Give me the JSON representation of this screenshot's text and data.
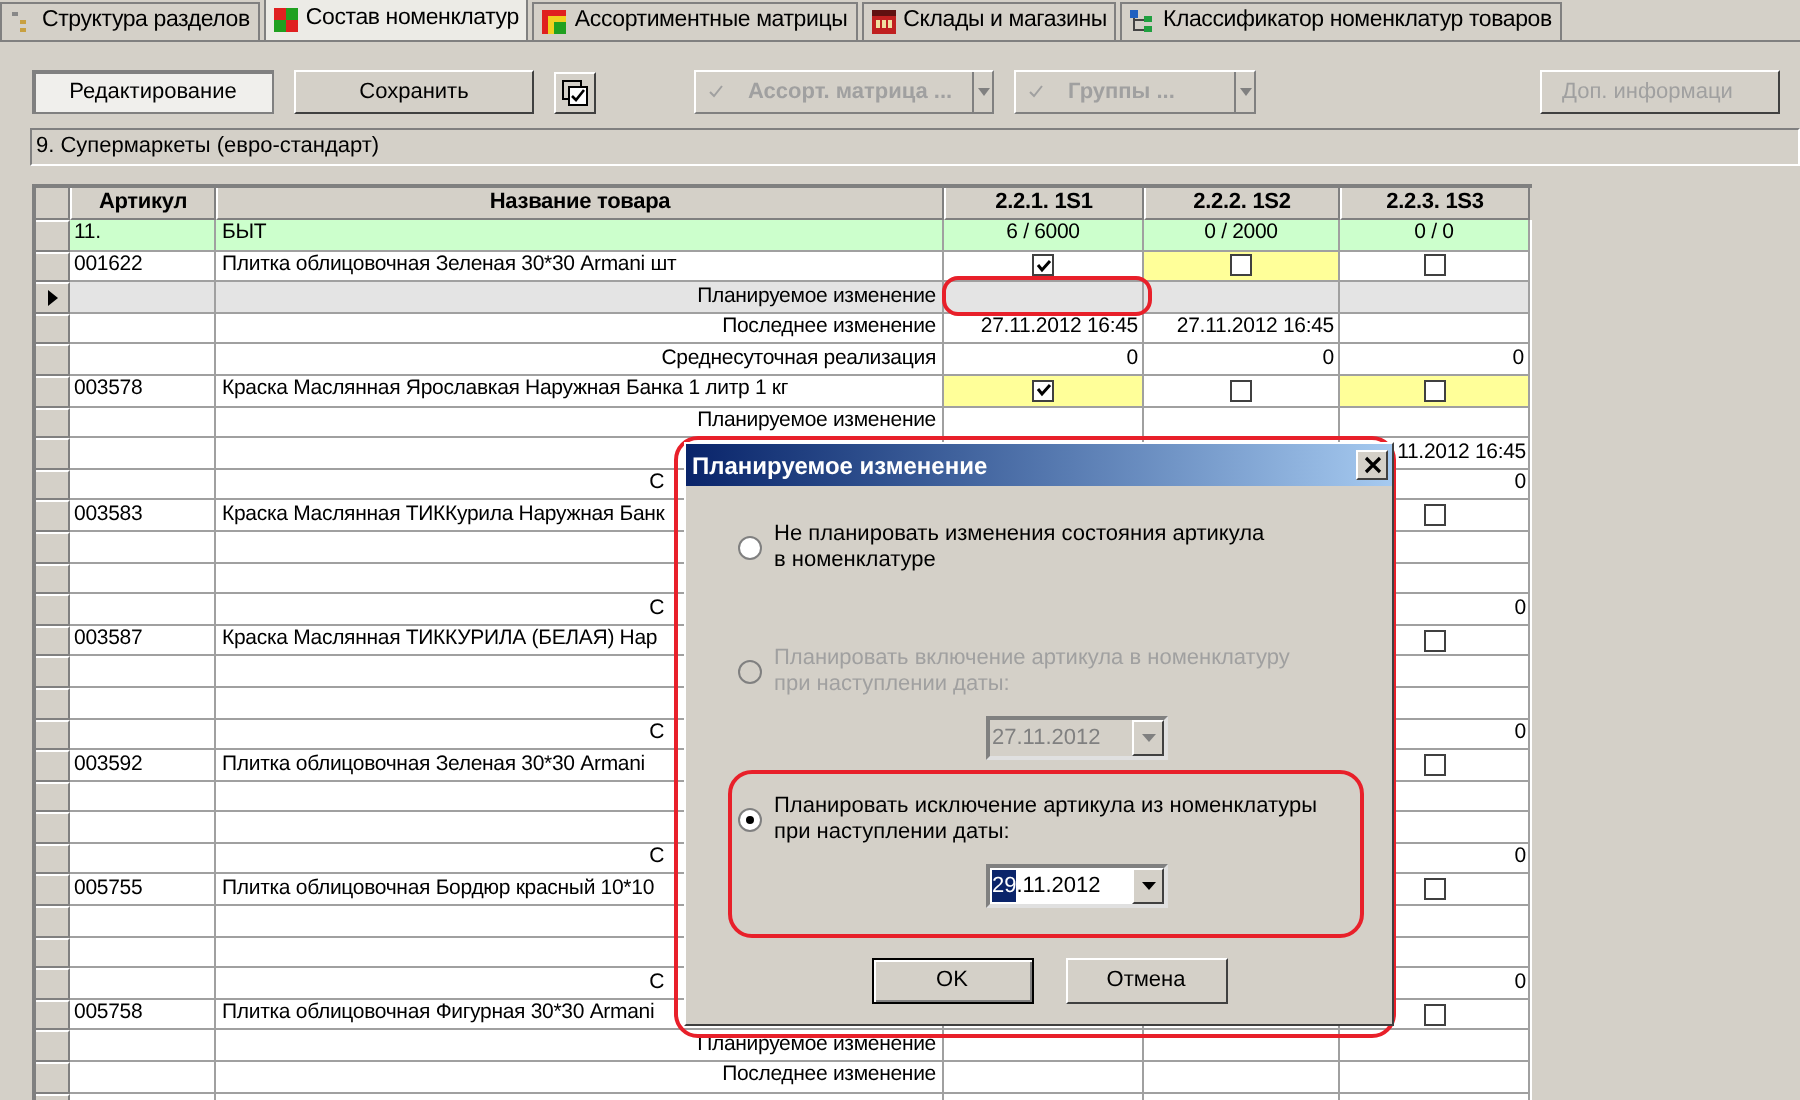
{
  "tabs": [
    {
      "label": "Структура разделов",
      "selected": false
    },
    {
      "label": "Состав номенклатур",
      "selected": true
    },
    {
      "label": "Ассортиментные матрицы",
      "selected": false
    },
    {
      "label": "Склады и магазины",
      "selected": false
    },
    {
      "label": "Классификатор номенклатур товаров",
      "selected": false
    }
  ],
  "toolbar": [
    {
      "kind": "button",
      "label": "Редактирование",
      "pressed": true,
      "disabled": false
    },
    {
      "kind": "button",
      "label": "Сохранить",
      "pressed": false,
      "disabled": false
    },
    {
      "kind": "icon"
    },
    {
      "kind": "dropdown",
      "label": "Ассорт. матрица ...",
      "disabled": true
    },
    {
      "kind": "dropdown",
      "label": "Группы ...",
      "disabled": true
    },
    {
      "kind": "button",
      "label": "Доп. информаци",
      "pressed": false,
      "disabled": true
    }
  ],
  "section": "9. Супермаркеты (евро-стандарт)",
  "table": {
    "columns": [
      "Артикул",
      "Название товара",
      "2.2.1. 1S1",
      "2.2.2. 1S2",
      "2.2.3. 1S3"
    ],
    "rows": [
      {
        "kind": "group",
        "selected": false,
        "cells": [
          {
            "kind": "text",
            "text": "11."
          },
          {
            "kind": "text",
            "text": "БЫТ"
          },
          {
            "kind": "text",
            "text": "6 / 6000"
          },
          {
            "kind": "text",
            "text": "0 / 2000"
          },
          {
            "kind": "text",
            "text": "0 / 0"
          }
        ]
      },
      {
        "kind": "product",
        "selected": false,
        "cells": [
          {
            "kind": "text",
            "text": "001622"
          },
          {
            "kind": "text",
            "text": "Плитка облицовочная Зеленая 30*30 Armani шт"
          },
          {
            "kind": "check",
            "checked": true,
            "highlight": false
          },
          {
            "kind": "check",
            "checked": false,
            "highlight": true
          },
          {
            "kind": "check",
            "checked": false,
            "highlight": false
          }
        ]
      },
      {
        "kind": "detail",
        "selected": true,
        "cells": [
          {
            "kind": "blank"
          },
          {
            "kind": "text",
            "text": "Планируемое изменение"
          },
          {
            "kind": "blank"
          },
          {
            "kind": "blank"
          },
          {
            "kind": "blank"
          }
        ]
      },
      {
        "kind": "detail",
        "selected": false,
        "cells": [
          {
            "kind": "blank"
          },
          {
            "kind": "text",
            "text": "Последнее изменение"
          },
          {
            "kind": "text",
            "text": "27.11.2012 16:45"
          },
          {
            "kind": "text",
            "text": "27.11.2012 16:45"
          },
          {
            "kind": "blank"
          }
        ]
      },
      {
        "kind": "detail",
        "selected": false,
        "cells": [
          {
            "kind": "blank"
          },
          {
            "kind": "text",
            "text": "Среднесуточная реализация"
          },
          {
            "kind": "text",
            "text": "0"
          },
          {
            "kind": "text",
            "text": "0"
          },
          {
            "kind": "text",
            "text": "0"
          }
        ]
      },
      {
        "kind": "product",
        "selected": false,
        "cells": [
          {
            "kind": "text",
            "text": "003578"
          },
          {
            "kind": "text",
            "text": "Краска Маслянная Ярославкая Наружная Банка 1 литр 1 кг"
          },
          {
            "kind": "check",
            "checked": true,
            "highlight": true
          },
          {
            "kind": "check",
            "checked": false,
            "highlight": false
          },
          {
            "kind": "check",
            "checked": false,
            "highlight": true
          }
        ]
      },
      {
        "kind": "detail",
        "selected": false,
        "cells": [
          {
            "kind": "blank"
          },
          {
            "kind": "text",
            "text": "Планируемое изменение"
          },
          {
            "kind": "blank"
          },
          {
            "kind": "blank"
          },
          {
            "kind": "blank"
          }
        ]
      },
      {
        "kind": "detail",
        "selected": false,
        "cells": [
          {
            "kind": "blank"
          },
          {
            "kind": "blank"
          },
          {
            "kind": "blank"
          },
          {
            "kind": "blank"
          },
          {
            "kind": "text",
            "text": "11.2012 16:45"
          }
        ]
      },
      {
        "kind": "detail",
        "selected": false,
        "cells": [
          {
            "kind": "blank"
          },
          {
            "kind": "text",
            "text": "С"
          },
          {
            "kind": "blank"
          },
          {
            "kind": "blank"
          },
          {
            "kind": "text",
            "text": "0"
          }
        ]
      },
      {
        "kind": "product",
        "selected": false,
        "cells": [
          {
            "kind": "text",
            "text": "003583"
          },
          {
            "kind": "text",
            "text": "Краска Маслянная ТИККурила Наружная Банк"
          },
          {
            "kind": "blank"
          },
          {
            "kind": "blank"
          },
          {
            "kind": "check",
            "checked": false,
            "highlight": false
          }
        ]
      },
      {
        "kind": "detail",
        "selected": false,
        "cells": [
          {
            "kind": "blank"
          },
          {
            "kind": "blank"
          },
          {
            "kind": "blank"
          },
          {
            "kind": "blank"
          },
          {
            "kind": "blank"
          }
        ]
      },
      {
        "kind": "detail",
        "selected": false,
        "cells": [
          {
            "kind": "blank"
          },
          {
            "kind": "blank"
          },
          {
            "kind": "blank"
          },
          {
            "kind": "blank"
          },
          {
            "kind": "blank"
          }
        ]
      },
      {
        "kind": "detail",
        "selected": false,
        "cells": [
          {
            "kind": "blank"
          },
          {
            "kind": "text",
            "text": "С"
          },
          {
            "kind": "blank"
          },
          {
            "kind": "blank"
          },
          {
            "kind": "text",
            "text": "0"
          }
        ]
      },
      {
        "kind": "product",
        "selected": false,
        "cells": [
          {
            "kind": "text",
            "text": "003587"
          },
          {
            "kind": "text",
            "text": "Краска Маслянная ТИККУРИЛА (БЕЛАЯ) Нар"
          },
          {
            "kind": "blank"
          },
          {
            "kind": "blank"
          },
          {
            "kind": "check",
            "checked": false,
            "highlight": false
          }
        ]
      },
      {
        "kind": "detail",
        "selected": false,
        "cells": [
          {
            "kind": "blank"
          },
          {
            "kind": "blank"
          },
          {
            "kind": "blank"
          },
          {
            "kind": "blank"
          },
          {
            "kind": "blank"
          }
        ]
      },
      {
        "kind": "detail",
        "selected": false,
        "cells": [
          {
            "kind": "blank"
          },
          {
            "kind": "blank"
          },
          {
            "kind": "blank"
          },
          {
            "kind": "blank"
          },
          {
            "kind": "blank"
          }
        ]
      },
      {
        "kind": "detail",
        "selected": false,
        "cells": [
          {
            "kind": "blank"
          },
          {
            "kind": "text",
            "text": "С"
          },
          {
            "kind": "blank"
          },
          {
            "kind": "blank"
          },
          {
            "kind": "text",
            "text": "0"
          }
        ]
      },
      {
        "kind": "product",
        "selected": false,
        "cells": [
          {
            "kind": "text",
            "text": "003592"
          },
          {
            "kind": "text",
            "text": "Плитка облицовочная Зеленая 30*30 Armani"
          },
          {
            "kind": "blank"
          },
          {
            "kind": "blank"
          },
          {
            "kind": "check",
            "checked": false,
            "highlight": false
          }
        ]
      },
      {
        "kind": "detail",
        "selected": false,
        "cells": [
          {
            "kind": "blank"
          },
          {
            "kind": "blank"
          },
          {
            "kind": "blank"
          },
          {
            "kind": "blank"
          },
          {
            "kind": "blank"
          }
        ]
      },
      {
        "kind": "detail",
        "selected": false,
        "cells": [
          {
            "kind": "blank"
          },
          {
            "kind": "blank"
          },
          {
            "kind": "blank"
          },
          {
            "kind": "blank"
          },
          {
            "kind": "blank"
          }
        ]
      },
      {
        "kind": "detail",
        "selected": false,
        "cells": [
          {
            "kind": "blank"
          },
          {
            "kind": "text",
            "text": "С"
          },
          {
            "kind": "blank"
          },
          {
            "kind": "blank"
          },
          {
            "kind": "text",
            "text": "0"
          }
        ]
      },
      {
        "kind": "product",
        "selected": false,
        "cells": [
          {
            "kind": "text",
            "text": "005755"
          },
          {
            "kind": "text",
            "text": "Плитка облицовочная Бордюр красный 10*10"
          },
          {
            "kind": "blank"
          },
          {
            "kind": "blank"
          },
          {
            "kind": "check",
            "checked": false,
            "highlight": false
          }
        ]
      },
      {
        "kind": "detail",
        "selected": false,
        "cells": [
          {
            "kind": "blank"
          },
          {
            "kind": "blank"
          },
          {
            "kind": "blank"
          },
          {
            "kind": "blank"
          },
          {
            "kind": "blank"
          }
        ]
      },
      {
        "kind": "detail",
        "selected": false,
        "cells": [
          {
            "kind": "blank"
          },
          {
            "kind": "blank"
          },
          {
            "kind": "blank"
          },
          {
            "kind": "blank"
          },
          {
            "kind": "blank"
          }
        ]
      },
      {
        "kind": "detail",
        "selected": false,
        "cells": [
          {
            "kind": "blank"
          },
          {
            "kind": "text",
            "text": "С"
          },
          {
            "kind": "blank"
          },
          {
            "kind": "blank"
          },
          {
            "kind": "text",
            "text": "0"
          }
        ]
      },
      {
        "kind": "product",
        "selected": false,
        "cells": [
          {
            "kind": "text",
            "text": "005758"
          },
          {
            "kind": "text",
            "text": "Плитка облицовочная Фигурная 30*30 Armani"
          },
          {
            "kind": "blank"
          },
          {
            "kind": "blank"
          },
          {
            "kind": "check",
            "checked": false,
            "highlight": false
          }
        ]
      },
      {
        "kind": "detail",
        "selected": false,
        "cells": [
          {
            "kind": "blank"
          },
          {
            "kind": "text",
            "text": "Планируемое изменение"
          },
          {
            "kind": "blank"
          },
          {
            "kind": "blank"
          },
          {
            "kind": "blank"
          }
        ]
      },
      {
        "kind": "detail",
        "selected": false,
        "cells": [
          {
            "kind": "blank"
          },
          {
            "kind": "text",
            "text": "Последнее изменение"
          },
          {
            "kind": "blank"
          },
          {
            "kind": "blank"
          },
          {
            "kind": "blank"
          }
        ]
      },
      {
        "kind": "detail",
        "selected": false,
        "cells": [
          {
            "kind": "blank"
          },
          {
            "kind": "blank"
          },
          {
            "kind": "blank"
          },
          {
            "kind": "blank"
          },
          {
            "kind": "blank"
          }
        ]
      }
    ]
  },
  "dialog": {
    "title": "Планируемое изменение",
    "options": [
      {
        "label": "Не планировать изменения состояния артикула\nв номенклатуре",
        "selected": false,
        "disabled": false
      },
      {
        "label": "Планировать включение артикула в номенклатуру\nпри наступлении даты:",
        "selected": false,
        "disabled": true,
        "date": {
          "value": "27.11.2012",
          "disabled": true
        }
      },
      {
        "label": "Планировать исключение артикула из номенклатуры\nпри наступлении даты:",
        "selected": true,
        "disabled": false,
        "date": {
          "value_selected": "29",
          "value": ".11.2012",
          "disabled": false
        }
      }
    ],
    "buttons": [
      {
        "label": "OK",
        "default": true
      },
      {
        "label": "Отмена",
        "default": false
      }
    ]
  }
}
